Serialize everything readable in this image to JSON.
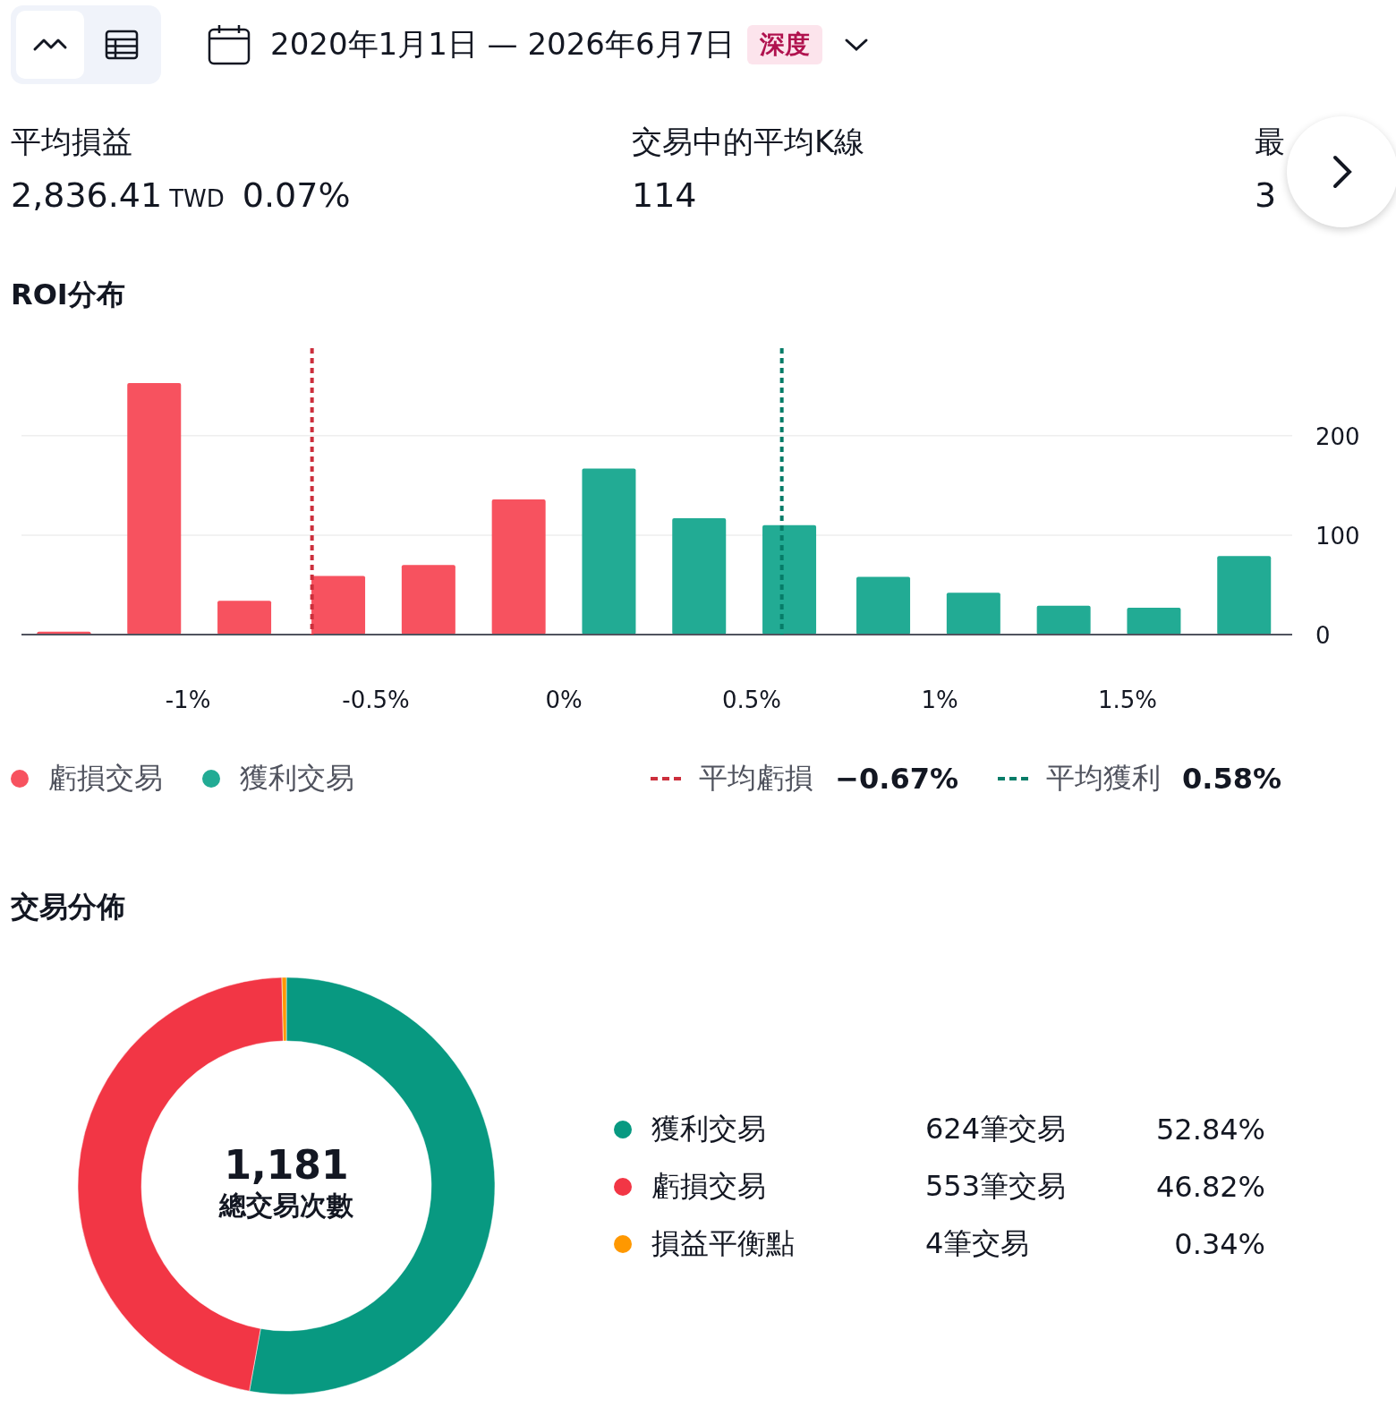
{
  "toolbar": {
    "view_toggle": [
      {
        "kind": "chart",
        "selected": true
      },
      {
        "kind": "table",
        "selected": false
      }
    ],
    "date_range": "2020年1月1日 — 2026年6月7日",
    "badge": "深度"
  },
  "stats": [
    {
      "label": "平均損益",
      "value": "2,836.41",
      "unit": "TWD",
      "extra": "0.07%"
    },
    {
      "label": "交易中的平均K線",
      "value": "114"
    },
    {
      "label": "最",
      "value": "3"
    }
  ],
  "roi": {
    "title": "ROI分布",
    "chart_data": {
      "type": "bar",
      "x": [
        -1.33,
        -1.09,
        -0.85,
        -0.6,
        -0.36,
        -0.12,
        0.12,
        0.36,
        0.6,
        0.85,
        1.09,
        1.33,
        1.57,
        1.81
      ],
      "series": [
        {
          "name": "虧損交易",
          "color": "#f7525f",
          "values": [
            3,
            253,
            34,
            59,
            70,
            136,
            null,
            null,
            null,
            null,
            null,
            null,
            null,
            null
          ]
        },
        {
          "name": "獲利交易",
          "color": "#22ab94",
          "values": [
            null,
            null,
            null,
            null,
            null,
            null,
            167,
            117,
            110,
            58,
            42,
            29,
            27,
            79
          ]
        }
      ],
      "xlim": [
        -1.443,
        1.938
      ],
      "ylim": [
        0,
        288
      ],
      "xticks": [
        {
          "value": -1,
          "label": "-1%"
        },
        {
          "value": -0.5,
          "label": "-0.5%"
        },
        {
          "value": 0,
          "label": "0%"
        },
        {
          "value": 0.5,
          "label": "0.5%"
        },
        {
          "value": 1,
          "label": "1%"
        },
        {
          "value": 1.5,
          "label": "1.5%"
        }
      ],
      "yticks": [
        0,
        100,
        200
      ],
      "ref_lines": [
        {
          "axis": "x",
          "value": -0.67,
          "color": "#cc2f3c"
        },
        {
          "axis": "x",
          "value": 0.58,
          "color": "#067c68"
        }
      ]
    },
    "legend": [
      {
        "label": "平均虧損",
        "value": "−0.67%",
        "color": "#cc2f3c"
      },
      {
        "label": "平均獲利",
        "value": "0.58%",
        "color": "#067c68"
      }
    ]
  },
  "trades": {
    "title": "交易分佈",
    "chart_data": {
      "type": "donut",
      "categories": [
        "獲利交易",
        "虧損交易",
        "損益平衡點"
      ],
      "series": [
        {
          "values": [
            52.84,
            46.82,
            0.34
          ]
        }
      ],
      "colors": [
        "#089981",
        "#f23645",
        "#ff9800"
      ]
    },
    "center_value": "1,181",
    "center_label": "總交易次數",
    "legend": [
      {
        "count": "624筆交易",
        "percent": "52.84%"
      },
      {
        "count": "553筆交易",
        "percent": "46.82%"
      },
      {
        "count": "4筆交易",
        "percent": "0.34%"
      }
    ]
  }
}
